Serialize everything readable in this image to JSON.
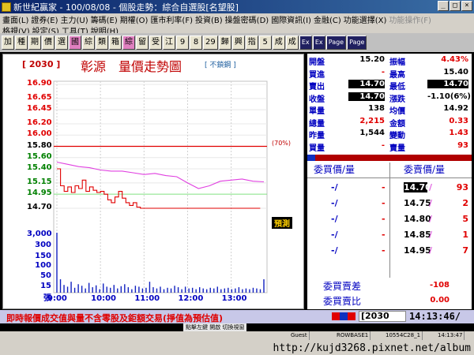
{
  "window": {
    "title": "新世紀贏家 - 100/08/08 - 個股走勢：綜合自選股[名望股]"
  },
  "menu": {
    "row1": [
      "畫面(L)",
      "證券(E)",
      "主力(U)",
      "籌碼(E)",
      "期權(O)",
      "匯市利率(F)",
      "投資(B)",
      "操盤密碼(D)",
      "國際資訊(I)",
      "金融(C)",
      "功能選擇(X)"
    ],
    "row1_disabled": "功能操作(F)",
    "row2": [
      "格視(V)",
      "設定(S)",
      "工具(T)",
      "說明(H)"
    ]
  },
  "toolbar": {
    "buttons": [
      "加",
      "種",
      "期",
      "價",
      "選",
      "國",
      "綜",
      "類",
      "箱",
      "綜",
      "留",
      "受",
      "江",
      "9",
      "8",
      "29",
      "歸",
      "興",
      "指",
      "5",
      "成",
      "成"
    ],
    "small": [
      "Ex",
      "Ex",
      "Page",
      "Page"
    ]
  },
  "chart": {
    "stock_code": "[ 2030 ]",
    "title": "彰源　量價走勢圖",
    "no_lock": "[ 不鎖鋼 ]",
    "ref_label": "(70%)",
    "predict_label": "預測",
    "volume_labels": [
      "3,000",
      "300",
      "150",
      "100",
      "50",
      "15",
      "張"
    ]
  },
  "chart_data": {
    "type": "line",
    "title": "彰源　量價走勢圖",
    "price_ticks": [
      "16.90",
      "16.65",
      "16.45",
      "16.20",
      "16.00",
      "15.80",
      "15.60",
      "15.40",
      "15.15",
      "14.95",
      "14.70"
    ],
    "time_ticks": [
      "9:00",
      "10:00",
      "11:00",
      "12:00",
      "13:00"
    ],
    "price_ylim": [
      14.7,
      16.9
    ],
    "reference_price": 15.8,
    "series": [
      {
        "name": "成交價",
        "color": "#e00000",
        "x": [
          0,
          5,
          10,
          15,
          20,
          25,
          30,
          35,
          40,
          45,
          50,
          55,
          60,
          65,
          70,
          75,
          80,
          85,
          90,
          95,
          100,
          105,
          110,
          115,
          120,
          280
        ],
        "values": [
          15.4,
          15.1,
          15.0,
          15.08,
          14.98,
          15.1,
          15.05,
          15.2,
          15.0,
          15.08,
          15.02,
          14.98,
          15.0,
          14.95,
          14.85,
          14.8,
          14.9,
          15.0,
          14.88,
          14.8,
          14.75,
          14.8,
          14.72,
          14.7,
          14.7,
          14.7
        ]
      },
      {
        "name": "均價",
        "color": "#e040e0",
        "x": [
          0,
          15,
          30,
          45,
          60,
          75,
          90,
          105,
          120,
          135,
          150,
          165,
          180,
          195,
          210,
          225,
          240,
          255,
          270,
          285
        ],
        "values": [
          15.52,
          15.48,
          15.44,
          15.42,
          15.38,
          15.36,
          15.36,
          15.33,
          15.3,
          15.32,
          15.28,
          15.26,
          15.15,
          15.05,
          15.1,
          15.18,
          15.2,
          15.22,
          15.18,
          15.17
        ]
      }
    ],
    "volume": [
      3000,
      150,
      50,
      30,
      100,
      20,
      60,
      40,
      15,
      80,
      25,
      45,
      10,
      70,
      30,
      20,
      50,
      15,
      35,
      60,
      25,
      10,
      40,
      30,
      15,
      20,
      100,
      25,
      15,
      30,
      10,
      20,
      15,
      40,
      25,
      10,
      30,
      15,
      20,
      10,
      25,
      15,
      10,
      20,
      15,
      30,
      10,
      15,
      20,
      10,
      15,
      25,
      10,
      15,
      10,
      20,
      15,
      10,
      150
    ]
  },
  "quote": [
    {
      "label": "開盤",
      "value": "15.20",
      "label2": "振幅",
      "value2": "4.43%"
    },
    {
      "label": "買進",
      "value": "-",
      "label2": "最高",
      "value2": "15.40"
    },
    {
      "label": "賣出",
      "value": "14.70",
      "label2": "最低",
      "value2": "14.70"
    },
    {
      "label": "收盤",
      "value": "14.70",
      "label2": "漲跌",
      "value2": "-1.10(6%)"
    },
    {
      "label": "單量",
      "value": "138",
      "label2": "均價",
      "value2": "14.92"
    },
    {
      "label": "總量",
      "value": "2,215",
      "label2": "金額",
      "value2": "0.33"
    },
    {
      "label": "昨量",
      "value": "1,544",
      "label2": "變動",
      "value2": "1.43"
    },
    {
      "label": "買量",
      "value": "-",
      "label2": "賣量",
      "value2": "93"
    }
  ],
  "orderbook": {
    "bid_header": "委買價/量",
    "ask_header": "委賣價/量",
    "rows": [
      {
        "bid_price": "-/",
        "bid_qty": "-",
        "ask_price": "14.70",
        "ask_qty": "93"
      },
      {
        "bid_price": "-/",
        "bid_qty": "-",
        "ask_price": "14.75",
        "ask_qty": "2"
      },
      {
        "bid_price": "-/",
        "bid_qty": "-",
        "ask_price": "14.80",
        "ask_qty": "5"
      },
      {
        "bid_price": "-/",
        "bid_qty": "-",
        "ask_price": "14.85",
        "ask_qty": "1"
      },
      {
        "bid_price": "-/",
        "bid_qty": "-",
        "ask_price": "14.95",
        "ask_qty": "7"
      }
    ],
    "diff_label": "委買賣差",
    "diff_value": "-108",
    "ratio_label": "委買賣比",
    "ratio_value": "0.00"
  },
  "status": {
    "text": "即時報價成交值與量不含零股及鉅額交易(掙值為預估值)",
    "code": "[2030",
    "clock": "14:13:46/",
    "colors": [
      "#e00000",
      "#1030c0",
      "#e00000"
    ]
  },
  "hint": {
    "text": "點擊左鍵 開啟 切換視窗"
  },
  "taskbar": {
    "cells": [
      "Guest",
      "ROWBASE1",
      "10554C28_1",
      "14:13:47"
    ]
  },
  "watermark": {
    "url": "http://kujd3268.pixnet.net/album"
  }
}
